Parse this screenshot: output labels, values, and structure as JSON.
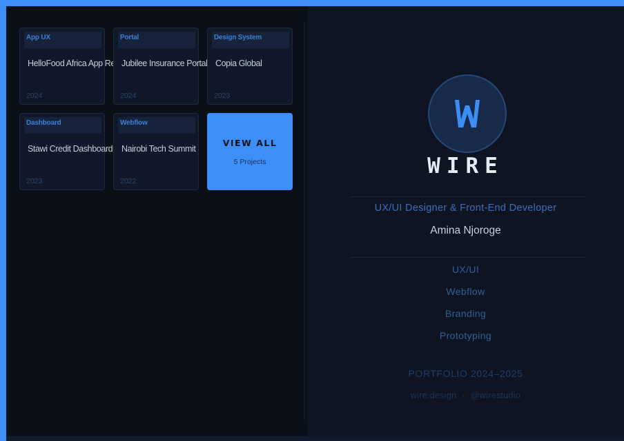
{
  "projects": [
    {
      "tag": "App UX",
      "title": "HelloFood Africa App Redesign",
      "year": "2024"
    },
    {
      "tag": "Portal",
      "title": "Jubilee Insurance Portal",
      "year": "2024"
    },
    {
      "tag": "Design System",
      "title": "Copia Global",
      "year": "2023"
    },
    {
      "tag": "Dashboard",
      "title": "Stawi Credit Dashboard",
      "year": "2023"
    },
    {
      "tag": "Webflow",
      "title": "Nairobi Tech Summit",
      "year": "2022"
    }
  ],
  "view_all": {
    "label": "VIEW ALL",
    "count": "5 Projects"
  },
  "profile": {
    "logo_letter": "W",
    "wordmark": "WIRE",
    "role": "UX/UI Designer & Front-End Developer",
    "name": "Amina Njoroge",
    "skills": [
      "UX/UI",
      "Webflow",
      "Branding",
      "Prototyping"
    ],
    "portfolio_label": "PORTFOLIO 2024–2025",
    "website": "wire.design",
    "separator": "·",
    "handle": "@wirestudio"
  },
  "colors": {
    "accent": "#3d8ef7",
    "background": "#0b0f18",
    "panel": "#0e1421"
  }
}
